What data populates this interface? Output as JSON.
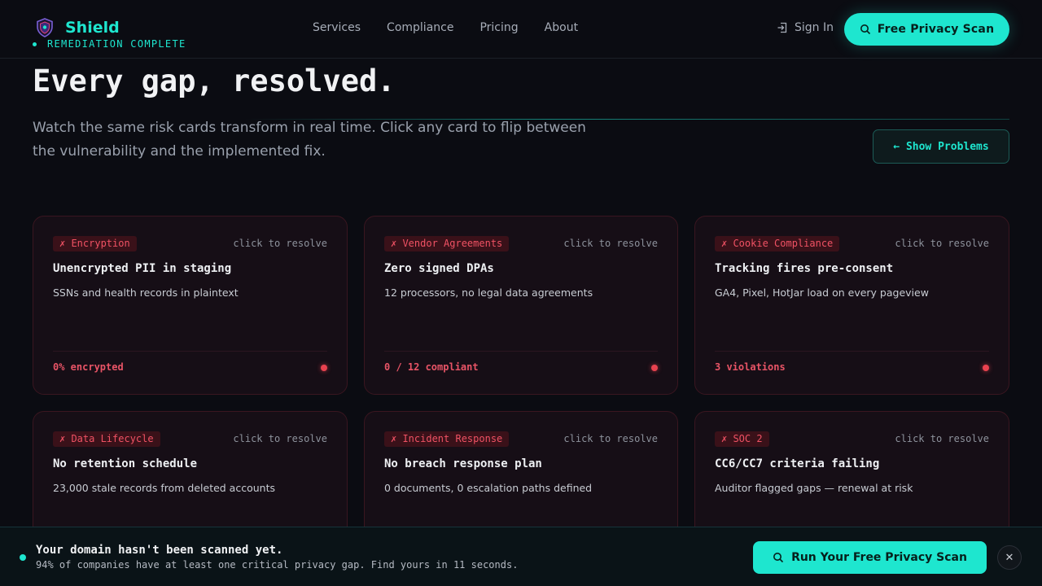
{
  "header": {
    "brand": "Shield",
    "status": "REMEDIATION COMPLETE",
    "nav": [
      "Services",
      "Compliance",
      "Pricing",
      "About"
    ],
    "sign_in": "Sign In",
    "cta": "Free Privacy Scan"
  },
  "hero": {
    "title": "Every gap, resolved.",
    "subtitle": "Watch the same risk cards transform in real time. Click any card to flip between the vulnerability and the implemented fix.",
    "toggle": "← Show Problems"
  },
  "cards": [
    {
      "tag": "✗ Encryption",
      "hint": "click to resolve",
      "title": "Unencrypted PII in staging",
      "desc": "SSNs and health records in plaintext",
      "metric": "0% encrypted"
    },
    {
      "tag": "✗ Vendor Agreements",
      "hint": "click to resolve",
      "title": "Zero signed DPAs",
      "desc": "12 processors, no legal data agreements",
      "metric": "0 / 12 compliant"
    },
    {
      "tag": "✗ Cookie Compliance",
      "hint": "click to resolve",
      "title": "Tracking fires pre-consent",
      "desc": "GA4, Pixel, HotJar load on every pageview",
      "metric": "3 violations"
    },
    {
      "tag": "✗ Data Lifecycle",
      "hint": "click to resolve",
      "title": "No retention schedule",
      "desc": "23,000 stale records from deleted accounts",
      "metric": ""
    },
    {
      "tag": "✗ Incident Response",
      "hint": "click to resolve",
      "title": "No breach response plan",
      "desc": "0 documents, 0 escalation paths defined",
      "metric": ""
    },
    {
      "tag": "✗ SOC 2",
      "hint": "click to resolve",
      "title": "CC6/CC7 criteria failing",
      "desc": "Auditor flagged gaps — renewal at risk",
      "metric": ""
    }
  ],
  "banner": {
    "title": "Your domain hasn't been scanned yet.",
    "subtitle": "94% of companies have at least one critical privacy gap. Find yours in 11 seconds.",
    "cta": "Run Your Free Privacy Scan",
    "close": "✕"
  },
  "colors": {
    "accent": "#1ee6cf",
    "danger": "#e8424f",
    "background": "#0b0c12"
  }
}
